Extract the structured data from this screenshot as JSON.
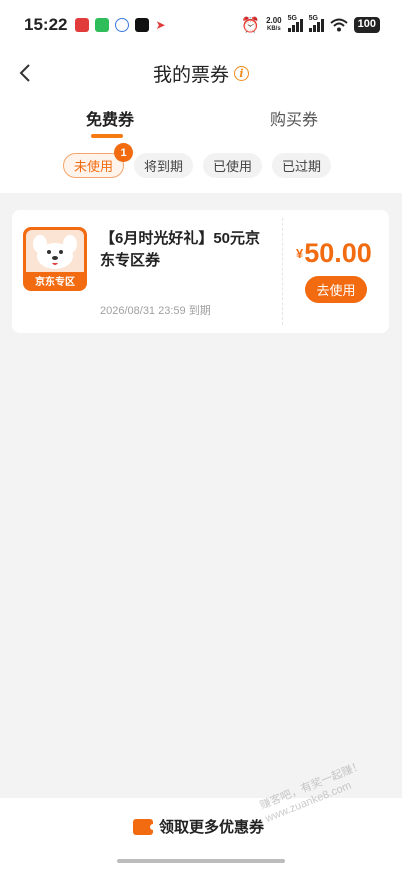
{
  "status_bar": {
    "time": "15:22",
    "net_speed_value": "2.00",
    "net_speed_unit": "KB/s",
    "sim1_label": "5G",
    "sim2_label": "5G",
    "battery": "100"
  },
  "nav": {
    "title": "我的票券"
  },
  "tabs": [
    {
      "label": "免费券",
      "active": true
    },
    {
      "label": "购买券",
      "active": false
    }
  ],
  "filters": [
    {
      "label": "未使用",
      "active": true,
      "badge": "1"
    },
    {
      "label": "将到期",
      "active": false
    },
    {
      "label": "已使用",
      "active": false
    },
    {
      "label": "已过期",
      "active": false
    }
  ],
  "coupon": {
    "image_label": "京东专区",
    "title": "【6月时光好礼】50元京东专区券",
    "expiry": "2026/08/31 23:59 到期",
    "currency": "¥",
    "amount": "50.00",
    "button_label": "去使用"
  },
  "bottom": {
    "more_label": "领取更多优惠券"
  },
  "watermark": {
    "line1": "赚客吧，有奖一起赚！",
    "line2": "www.zuanke8.com"
  },
  "colors": {
    "accent": "#f26b10",
    "background": "#f3f3f3"
  },
  "icons": [
    "back-arrow-icon",
    "info-icon",
    "ticket-icon",
    "alarm-icon",
    "wifi-icon",
    "signal-icon"
  ]
}
